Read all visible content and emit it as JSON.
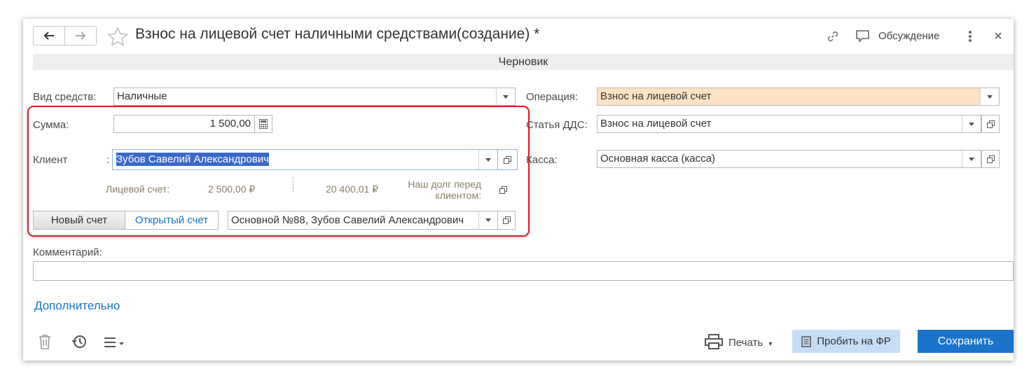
{
  "window": {
    "title": "Взнос на лицевой счет наличными средствами(создание) *",
    "status": "Черновик",
    "discussion_label": "Обсуждение"
  },
  "form": {
    "funds_type_label": "Вид средств:",
    "funds_type_value": "Наличные",
    "operation_label": "Операция:",
    "operation_value": "Взнос на лицевой счет",
    "amount_label": "Сумма:",
    "amount_value": "1 500,00",
    "dds_label": "Статья ДДС:",
    "dds_value": "Взнос на лицевой счет",
    "client_label": "Клиент",
    "client_colon": ":",
    "client_value": "Зубов Савелий Александрович",
    "cashbox_label": "Касса:",
    "cashbox_value": "Основная касса (касса)",
    "personal_account_label": "Лицевой счет:",
    "personal_account_value": "2 500,00 ₽",
    "debt_value": "20 400,01 ₽",
    "debt_label_line1": "Наш долг перед",
    "debt_label_line2": "клиентом:",
    "new_account_label": "Новый счет",
    "open_account_label": "Открытый счет",
    "account_value": "Основной №88, Зубов Савелий Александрович",
    "comment_label": "Комментарий:",
    "comment_value": "",
    "additional_link": "Дополнительно"
  },
  "toolbar": {
    "print_label": "Печать",
    "fiscal_label": "Пробить на ФР",
    "save_label": "Сохранить"
  },
  "colors": {
    "accent": "#1a74c9",
    "highlight_frame": "#d62027",
    "operation_bg": "#fde3c3",
    "selection": "#3b69c8",
    "fiscal_bg": "#c6ddf7",
    "save_bg": "#1a74c9"
  }
}
